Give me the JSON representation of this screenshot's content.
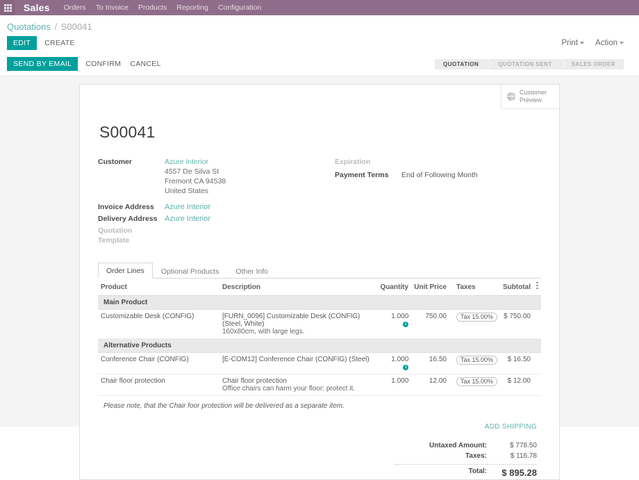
{
  "navbar": {
    "apps_icon": "apps-grid-icon",
    "brand": "Sales",
    "menu": [
      "Orders",
      "To Invoice",
      "Products",
      "Reporting",
      "Configuration"
    ]
  },
  "breadcrumb": {
    "parent": "Quotations",
    "separator": "/",
    "current": "S00041"
  },
  "toolbar": {
    "edit_label": "EDIT",
    "create_label": "CREATE",
    "print_label": "Print",
    "action_label": "Action"
  },
  "actionbar": {
    "send_by_email_label": "SEND BY EMAIL",
    "confirm_label": "CONFIRM",
    "cancel_label": "CANCEL"
  },
  "statusbar": {
    "stages": [
      {
        "label": "QUOTATION",
        "active": true
      },
      {
        "label": "QUOTATION SENT",
        "active": false
      },
      {
        "label": "SALES ORDER",
        "active": false
      }
    ]
  },
  "customer_preview": {
    "icon": "globe-icon",
    "line1": "Customer",
    "line2": "Preview"
  },
  "document": {
    "title": "S00041",
    "left_fields": {
      "customer_label": "Customer",
      "customer_value": "Azure Interior",
      "address_line1": "4557 De Silva St",
      "address_line2": "Fremont CA 94538",
      "address_line3": "United States",
      "invoice_address_label": "Invoice Address",
      "invoice_address_value": "Azure Interior",
      "delivery_address_label": "Delivery Address",
      "delivery_address_value": "Azure Interior",
      "quotation_template_label": "Quotation Template",
      "quotation_template_value": ""
    },
    "right_fields": {
      "expiration_label": "Expiration",
      "expiration_value": "",
      "payment_terms_label": "Payment Terms",
      "payment_terms_value": "End of Following Month"
    }
  },
  "tabs": [
    {
      "label": "Order Lines",
      "active": true
    },
    {
      "label": "Optional Products",
      "active": false
    },
    {
      "label": "Other Info",
      "active": false
    }
  ],
  "order_lines": {
    "columns": {
      "product": "Product",
      "description": "Description",
      "quantity": "Quantity",
      "unit_price": "Unit Price",
      "taxes": "Taxes",
      "subtotal": "Subtotal",
      "options_icon": "column-options-icon"
    },
    "sections": [
      {
        "title": "Main Product",
        "rows": [
          {
            "product": "Customizable Desk (CONFIG)",
            "description": "[FURN_0096] Customizable Desk (CONFIG) (Steel, White)",
            "description_sub": "160x80cm, with large legs.",
            "quantity": "1.000",
            "has_info": true,
            "unit_price": "750.00",
            "taxes": "Tax 15.00%",
            "subtotal": "$ 750.00"
          }
        ]
      },
      {
        "title": "Alternative Products",
        "rows": [
          {
            "product": "Conference Chair (CONFIG)",
            "description": "[E-COM12] Conference Chair (CONFIG) (Steel)",
            "description_sub": "",
            "quantity": "1.000",
            "has_info": true,
            "unit_price": "16.50",
            "taxes": "Tax 15.00%",
            "subtotal": "$ 16.50"
          },
          {
            "product": "Chair floor protection",
            "description": "Chair floor protection",
            "description_sub": "Office chairs can harm your floor: protect it.",
            "quantity": "1.000",
            "has_info": false,
            "unit_price": "12.00",
            "taxes": "Tax 15.00%",
            "subtotal": "$ 12.00"
          }
        ]
      }
    ],
    "note": "Please note, that the Chair foor protection will be delivered as a separate item.",
    "add_shipping_label": "ADD SHIPPING"
  },
  "totals": {
    "untaxed_label": "Untaxed Amount:",
    "untaxed_value": "$ 778.50",
    "taxes_label": "Taxes:",
    "taxes_value": "$ 116.78",
    "total_label": "Total:",
    "total_value": "$ 895.28"
  },
  "colors": {
    "navbar_purple": "#8f6d8a",
    "accent_teal": "#00a09d",
    "link_teal": "#5bb2ab",
    "page_bg": "#f4f4f4"
  }
}
